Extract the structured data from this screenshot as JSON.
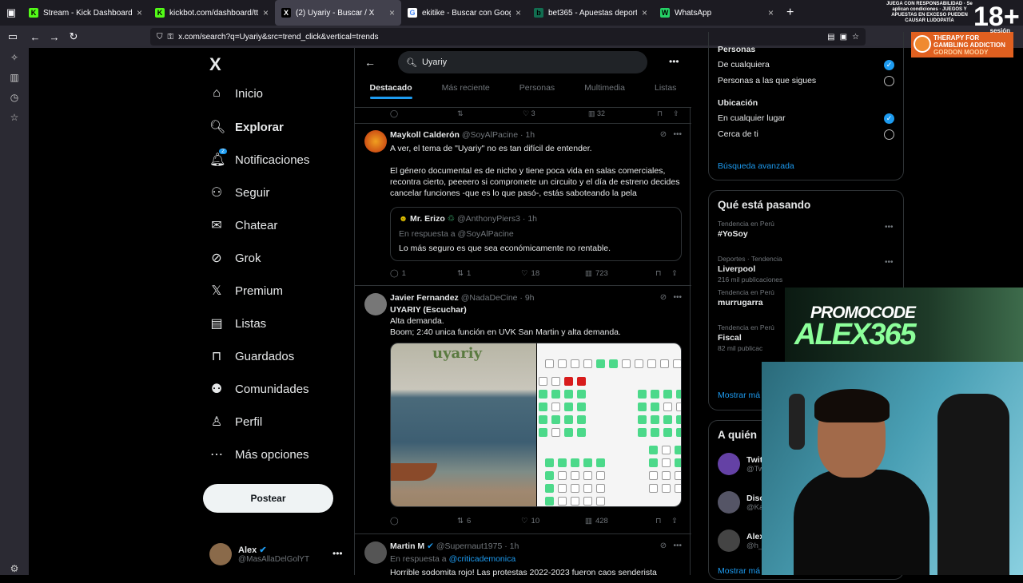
{
  "browser": {
    "tabs": [
      {
        "label": "Stream - Kick Dashboard",
        "fav": "K",
        "color": "#53fc18",
        "active": false
      },
      {
        "label": "kickbot.com/dashboard/tts/con",
        "fav": "K",
        "color": "#53fc18",
        "active": false
      },
      {
        "label": "(2) Uyariy - Buscar / X",
        "fav": "X",
        "color": "#000000",
        "active": true
      },
      {
        "label": "ekitike - Buscar con Google",
        "fav": "G",
        "color": "#ffffff",
        "active": false
      },
      {
        "label": "bet365 - Apuestas deportivas e",
        "fav": "b",
        "color": "#126e51",
        "active": false
      },
      {
        "label": "WhatsApp",
        "fav": "W",
        "color": "#25d366",
        "active": false
      }
    ],
    "url": "x.com/search?q=Uyariy&src=trend_click&vertical=trends"
  },
  "overlay": {
    "responsible_text": "JUEGA CON RESPONSABILIDAD · Se aplican condiciones · JUEGOS Y APUESTAS EN EXCESO PUEDEN CAUSAR LUDOPATÍA",
    "age": "18+",
    "therapy": "THERAPY FOR GAMBLING ADDICTION",
    "therapy_by": "GORDON MOODY",
    "session": "sesión",
    "promo_line1": "PROMOCODE",
    "promo_line2": "ALEX365"
  },
  "nav": {
    "logo": "X",
    "items": [
      "Inicio",
      "Explorar",
      "Notificaciones",
      "Seguir",
      "Chatear",
      "Grok",
      "Premium",
      "Listas",
      "Guardados",
      "Comunidades",
      "Perfil",
      "Más opciones"
    ],
    "notif_badge": "2",
    "post_label": "Postear",
    "user_name": "Alex",
    "user_handle": "@MasAllaDelGolYT"
  },
  "search": {
    "query": "Uyariy",
    "tabs": [
      "Destacado",
      "Más reciente",
      "Personas",
      "Multimedia",
      "Listas"
    ]
  },
  "prev_actions": {
    "likes": "3",
    "views": "32"
  },
  "tweets": [
    {
      "name": "Maykoll Calderón",
      "handle": "@SoyAlPacine",
      "time": "1h",
      "line1": "A ver, el tema de \"Uyariy\" no es tan difícil de entender.",
      "body": "El género documental es de nicho y tiene poca vida en salas comerciales, recontra cierto, peeeero si compromete un circuito y el día de estreno decides cancelar funciones -que es lo que pasó-, estás saboteando la pela",
      "quote": {
        "name": "Mr. Erizo",
        "handle": "@AnthonyPiers3",
        "time": "1h",
        "reply": "En respuesta a @SoyAlPacine",
        "text": "Lo más seguro es que sea económicamente no rentable."
      },
      "replies": "1",
      "reposts": "1",
      "likes": "18",
      "views": "723"
    },
    {
      "name": "Javier Fernandez",
      "handle": "@NadaDeCine",
      "time": "9h",
      "line1": "UYARIY  (Escuchar)",
      "line2": "Alta demanda.",
      "line3": "Boom; 2:40 unica función en UVK San Martin y alta demanda.",
      "media_text": "uyariy",
      "replies": "",
      "reposts": "6",
      "likes": "10",
      "views": "428"
    },
    {
      "name": "Martin M",
      "handle": "@Supernaut1975",
      "time": "1h",
      "reply_prefix": "En respuesta a",
      "reply_to": "@criticademonica",
      "body": "Horrible sodomita rojo! Las protestas 2022-2023 fueron caos senderista"
    }
  ],
  "filters": {
    "people_title": "Personas",
    "people_opts": [
      "De cualquiera",
      "Personas a las que sigues"
    ],
    "loc_title": "Ubicación",
    "loc_opts": [
      "En cualquier lugar",
      "Cerca de ti"
    ],
    "advanced": "Búsqueda avanzada"
  },
  "trending": {
    "title": "Qué está pasando",
    "items": [
      {
        "cat": "Tendencia en Perú",
        "name": "#YoSoy",
        "posts": ""
      },
      {
        "cat": "Deportes · Tendencia",
        "name": "Liverpool",
        "posts": "216 mil publicaciones"
      },
      {
        "cat": "Tendencia en Perú",
        "name": "murrugarra",
        "posts": ""
      },
      {
        "cat": "Tendencia en Perú",
        "name": "Fiscal",
        "posts": "82 mil publicac"
      }
    ],
    "more": "Mostrar má"
  },
  "who_follow": {
    "title": "A quién",
    "items": [
      {
        "name": "Twit",
        "handle": "@Tw"
      },
      {
        "name": "Disc",
        "handle": "@Ka"
      },
      {
        "name": "Alex",
        "handle": "@h_"
      }
    ],
    "more": "Mostrar má"
  }
}
